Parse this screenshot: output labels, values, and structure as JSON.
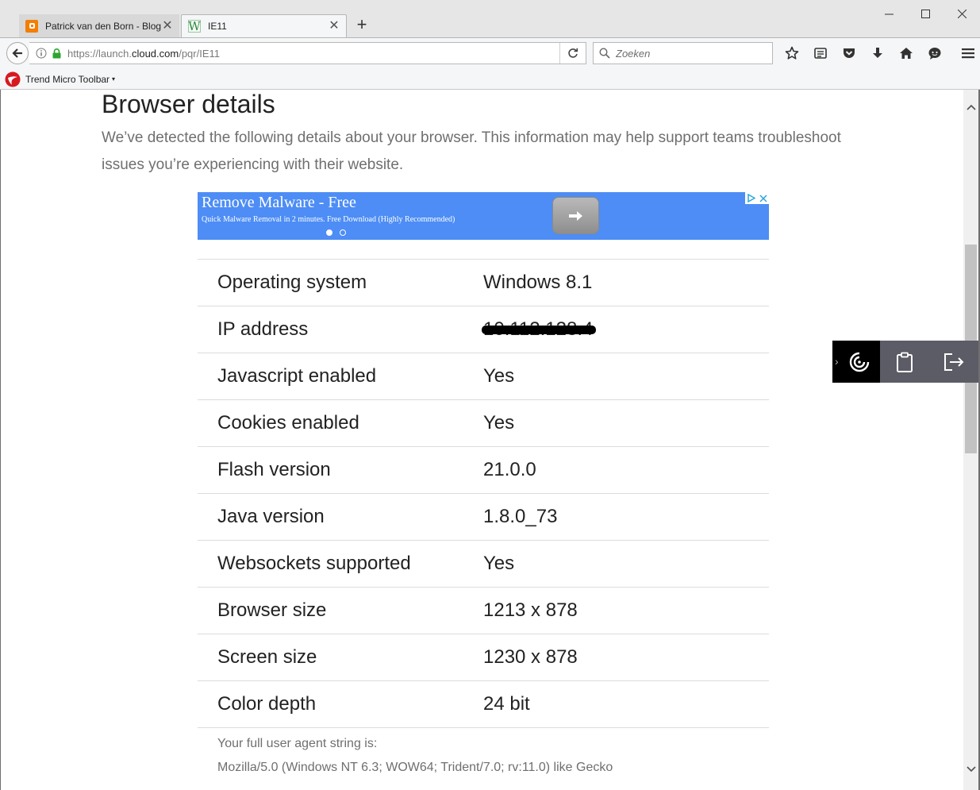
{
  "tabs": [
    {
      "label": "Patrick van den Born - Blog",
      "favicon": "blogger-icon",
      "active": false
    },
    {
      "label": "IE11",
      "favicon": "w-icon",
      "active": true
    }
  ],
  "window_controls": {
    "minimize": "minimize-icon",
    "maximize": "maximize-icon",
    "close": "close-icon"
  },
  "navbar": {
    "url_prefix": "https://launch.",
    "url_domain": "cloud.com",
    "url_path": "/pqr/IE11",
    "search_placeholder": "Zoeken"
  },
  "bookmarks_bar": {
    "trend_micro_label": "Trend Micro Toolbar",
    "caret": "▾"
  },
  "page": {
    "title": "Browser details",
    "description": "We’ve detected the following details about your browser. This information may help support teams troubleshoot issues you’re experiencing with their website."
  },
  "ad": {
    "title": "Remove Malware - Free",
    "subtitle": "Quick Malware Removal in 2 minutes. Free Download (Highly Recommended)",
    "color": "#4d8df5"
  },
  "details": [
    {
      "key": "Operating system",
      "value": "Windows 8.1"
    },
    {
      "key": "IP address",
      "value": "10.112.128.4",
      "redacted": true
    },
    {
      "key": "Javascript enabled",
      "value": "Yes"
    },
    {
      "key": "Cookies enabled",
      "value": "Yes"
    },
    {
      "key": "Flash version",
      "value": "21.0.0"
    },
    {
      "key": "Java version",
      "value": "1.8.0_73"
    },
    {
      "key": "Websockets supported",
      "value": "Yes"
    },
    {
      "key": "Browser size",
      "value": "1213 x 878"
    },
    {
      "key": "Screen size",
      "value": "1230 x 878"
    },
    {
      "key": "Color depth",
      "value": "24 bit"
    }
  ],
  "user_agent": {
    "label": "Your full user agent string is:",
    "value": "Mozilla/5.0 (Windows NT 6.3; WOW64; Trident/7.0; rv:11.0) like Gecko"
  },
  "colors": {
    "widget_dark": "#000000",
    "widget_gray": "#5c5c67"
  }
}
